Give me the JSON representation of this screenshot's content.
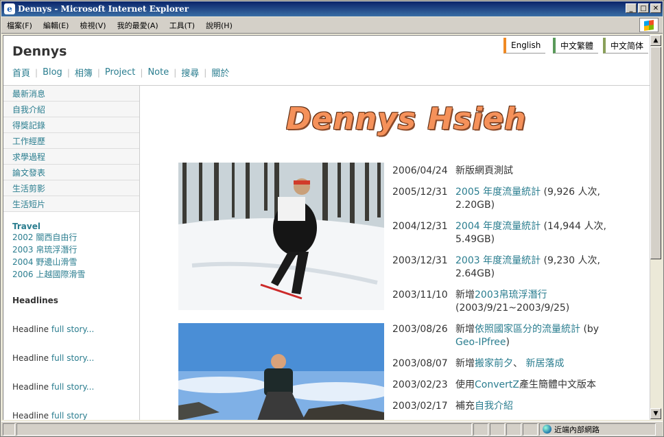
{
  "window": {
    "title": "Dennys - Microsoft Internet Explorer"
  },
  "menu": [
    "檔案(F)",
    "編輯(E)",
    "檢視(V)",
    "我的最愛(A)",
    "工具(T)",
    "說明(H)"
  ],
  "site": {
    "title": "Dennys",
    "languages": [
      {
        "label": "English",
        "color": "#f08a24"
      },
      {
        "label": "中文繁體",
        "color": "#5a9a5a"
      },
      {
        "label": "中文简体",
        "color": "#8aa05a"
      }
    ],
    "nav": [
      "首頁",
      "Blog",
      "相簿",
      "Project",
      "Note",
      "搜尋",
      "關於"
    ],
    "banner": "Dennys Hsieh"
  },
  "sidebar": {
    "items": [
      "最新消息",
      "自我介紹",
      "得獎記錄",
      "工作經歷",
      "求學過程",
      "論文發表",
      "生活剪影",
      "生活短片"
    ],
    "travel_heading": "Travel",
    "travel": [
      "2002 關西自由行",
      "2003 帛琉浮潛行",
      "2004 野邊山滑雪",
      "2006 上越國際滑雪"
    ],
    "headlines_heading": "Headlines",
    "headline_text": "Headline",
    "headline_link": "full story...",
    "last_headline_link": "full story"
  },
  "news": [
    {
      "date": "2006/04/24",
      "pre": "新版網頁測試",
      "link": "",
      "post": ""
    },
    {
      "date": "2005/12/31",
      "pre": "",
      "link": "2005 年度流量統計",
      "post": " (9,926 人次, 2.20GB)"
    },
    {
      "date": "2004/12/31",
      "pre": "",
      "link": "2004 年度流量統計",
      "post": " (14,944 人次, 5.49GB)"
    },
    {
      "date": "2003/12/31",
      "pre": "",
      "link": "2003 年度流量統計",
      "post": " (9,230 人次, 2.64GB)"
    },
    {
      "date": "2003/11/10",
      "pre": "新增",
      "link": "2003帛琉浮潛行",
      "post": " (2003/9/21~2003/9/25)"
    },
    {
      "date": "2003/08/26",
      "pre": "新增",
      "link": "依照國家區分的流量統計",
      "post": " (by ",
      "link2": "Geo-IPfree",
      "post2": ")"
    },
    {
      "date": "2003/08/07",
      "pre": "新增",
      "link": "搬家前夕",
      "post": "、 ",
      "link2": "新居落成",
      "post2": ""
    },
    {
      "date": "2003/02/23",
      "pre": "使用",
      "link": "ConvertZ",
      "post": "產生簡體中文版本"
    },
    {
      "date": "2003/02/17",
      "pre": "補充",
      "link": "自我介紹",
      "post": ""
    }
  ],
  "status": {
    "zone": "近端內部網路"
  }
}
